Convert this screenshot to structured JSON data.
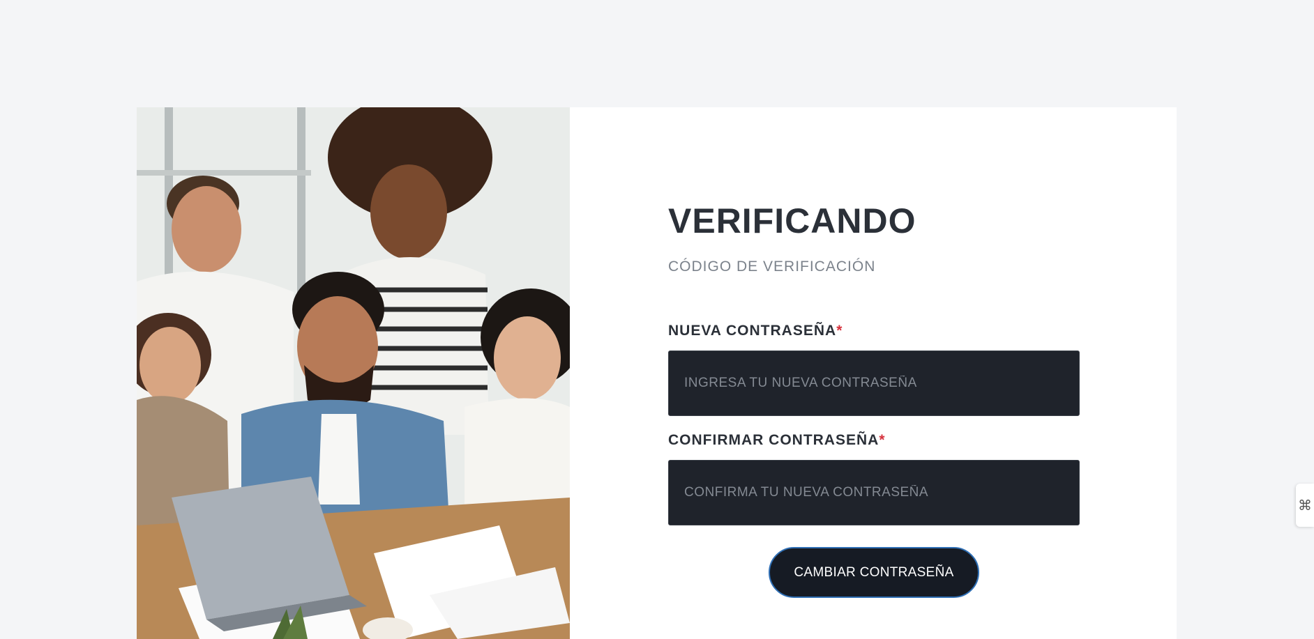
{
  "heading": {
    "title": "VERIFICANDO",
    "subtitle": "CÓDIGO DE VERIFICACIÓN"
  },
  "form": {
    "new_password": {
      "label": "NUEVA CONTRASEÑA",
      "required_mark": "*",
      "placeholder": "INGRESA TU NUEVA CONTRASEÑA",
      "value": ""
    },
    "confirm_password": {
      "label": "CONFIRMAR CONTRASEÑA",
      "required_mark": "*",
      "placeholder": "CONFIRMA TU NUEVA CONTRASEÑA",
      "value": ""
    },
    "submit_label": "CAMBIAR CONTRASEÑA"
  },
  "side_tab": {
    "icon": "translate-widget-icon",
    "glyph": "⌘"
  },
  "colors": {
    "background": "#f4f5f7",
    "card": "#ffffff",
    "input_bg": "#1f232b",
    "button_bg": "#161b24",
    "button_border": "#2f6fb5",
    "required": "#d6323d",
    "heading": "#2b3038"
  }
}
